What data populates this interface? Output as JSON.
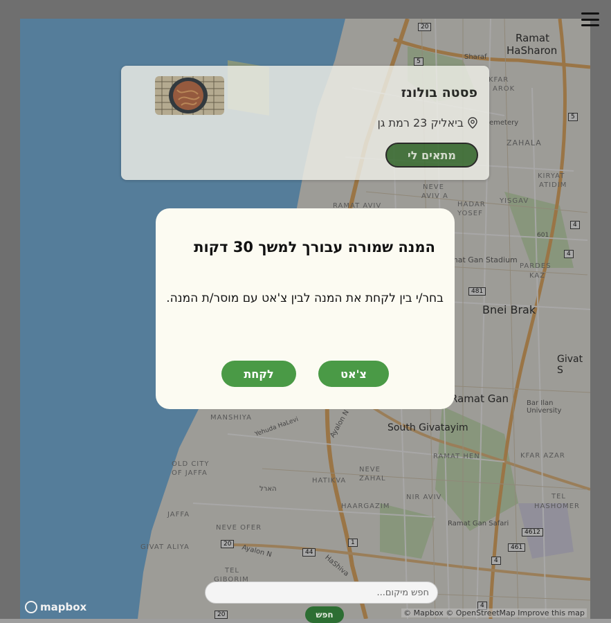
{
  "header": {
    "menu_icon": "hamburger-menu-icon"
  },
  "dish_card": {
    "title": "פסטה בולונז",
    "address": "ביאליק 23 רמת גן",
    "address_icon": "location-pin-icon",
    "match_button": "מתאים לי"
  },
  "map": {
    "labels": {
      "ramat_hasharon_1": "Ramat",
      "ramat_hasharon_2": "HaSharon",
      "bnei_brak": "Bnei Brak",
      "givat_s": "Givat S",
      "ramat_gan": "Ramat Gan",
      "south_givatayim": "South Givatayim",
      "zahala": "ZAHALA",
      "kiryat_atidim_1": "KIRYAT",
      "kiryat_atidim_2": "ATIDIM",
      "yisgav": "YISGAV",
      "hadar_yosef_1": "HADAR",
      "hadar_yosef_2": "YOSEF",
      "ramat_aviv": "RAMAT AVIV",
      "neve_aviv_1": "NEVE",
      "neve_aviv_2": "AVIV A",
      "pardes_kaz_1": "PARDES",
      "pardes_kaz_2": "KAZ",
      "ramat_gan_stadium": "mat Gan Stadium",
      "kfar_azar": "KFAR AZAR",
      "bar_ilan": "Bar Ilan University",
      "manshiya": "MANSHIYA",
      "ramat_hen": "RAMAT HEN",
      "old_jaffa_1": "OLD CITY",
      "old_jaffa_2": "OF JAFFA",
      "neve_zahal_1": "NEVE",
      "neve_zahal_2": "ZAHAL",
      "hatikva": "HATIKVA",
      "nir_aviv": "NIR AVIV",
      "haargazim": "HAARGAZIM",
      "jaffa": "JAFFA",
      "tel_hashomer_1": "TEL",
      "tel_hashomer_2": "HASHOMER",
      "ramat_gan_safari": "Ramat Gan Safari",
      "neve_ofer": "NEVE OFER",
      "givat_aliya": "GIVAT ALIYA",
      "tel_giborim_1": "TEL",
      "tel_giborim_2": "GIBORIM",
      "harel": "הארל",
      "ayalon_n": "Ayalon N",
      "ayalon_n2": "Ayalon N",
      "hashiva": "HaShiva",
      "yehuda_halevi": "Yehuda HaLevi",
      "sharaf": "Sharaf",
      "emetery": "emetery",
      "kfar_arok": "KFAR",
      "arok": "AROK",
      "road_20a": "20",
      "road_5a": "5",
      "road_5b": "5",
      "road_4a": "4",
      "road_4b": "4",
      "road_481": "481",
      "road_4612": "4612",
      "road_461": "461",
      "road_20b": "20",
      "road_44": "44",
      "road_1": "1",
      "road_4c": "4",
      "road_20c": "20",
      "road_4d": "4",
      "road_601": "601"
    }
  },
  "search": {
    "placeholder": "חפש מיקום...",
    "button": "חפש"
  },
  "mapbox": {
    "logo_text": "mapbox",
    "attribution": "© Mapbox © OpenStreetMap  Improve this map"
  },
  "modal": {
    "title": "המנה שמורה עבורך למשך 30 דקות",
    "body": "בחר/י בין לקחת את המנה לבין צ'אט עם מוסר/ת המנה.",
    "chat_button": "צ'אט",
    "take_button": "לקחת"
  },
  "colors": {
    "sea": "#73b6e6",
    "primary_green": "#4a9a46",
    "dark_green": "#356b2c",
    "modal_bg": "#fcfbf2"
  }
}
